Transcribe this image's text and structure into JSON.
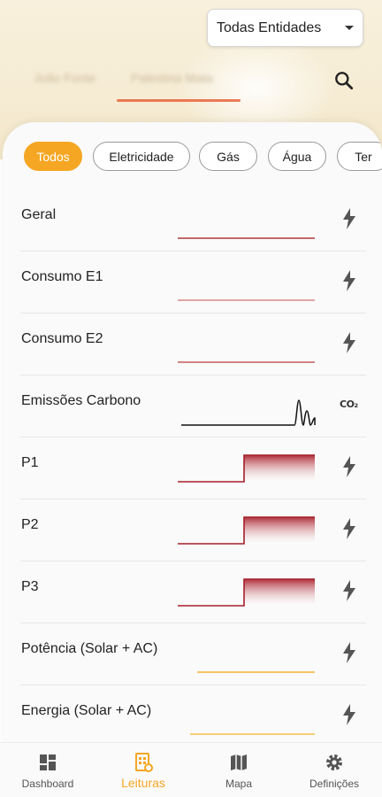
{
  "header": {
    "entity_select_value": "Todas Entidades",
    "tabs": [
      "João Fonte",
      "Palestina Mata"
    ],
    "search_icon": "search-icon",
    "colors": {
      "accent": "#f5a623",
      "tab_indicator": "#e8643c"
    }
  },
  "filters": {
    "chips": [
      {
        "label": "Todos",
        "active": true
      },
      {
        "label": "Eletricidade",
        "active": false
      },
      {
        "label": "Gás",
        "active": false
      },
      {
        "label": "Água",
        "active": false
      },
      {
        "label": "Ter",
        "active": false
      }
    ]
  },
  "readings": [
    {
      "label": "Geral",
      "icon": "bolt-icon",
      "spark_type": "flat",
      "color": "#b03a3a"
    },
    {
      "label": "Consumo E1",
      "icon": "bolt-icon",
      "spark_type": "flat",
      "color": "#d88888"
    },
    {
      "label": "Consumo E2",
      "icon": "bolt-icon",
      "spark_type": "flat",
      "color": "#c85a5a"
    },
    {
      "label": "Emissões Carbono",
      "icon": "co2-icon",
      "icon_text": "CO₂",
      "spark_type": "spike",
      "color": "#111111"
    },
    {
      "label": "P1",
      "icon": "bolt-icon",
      "spark_type": "step",
      "color": "#a31f2a"
    },
    {
      "label": "P2",
      "icon": "bolt-icon",
      "spark_type": "step",
      "color": "#a31f2a"
    },
    {
      "label": "P3",
      "icon": "bolt-icon",
      "spark_type": "step",
      "color": "#a31f2a"
    },
    {
      "label": "Potência (Solar + AC)",
      "icon": "bolt-icon",
      "spark_type": "flat-short",
      "color": "#f2b233"
    },
    {
      "label": "Energia (Solar + AC)",
      "icon": "bolt-icon",
      "spark_type": "flat-short",
      "color": "#f2c04a"
    }
  ],
  "bottom_nav": [
    {
      "label": "Dashboard",
      "icon": "dashboard-icon",
      "active": false
    },
    {
      "label": "Leituras",
      "icon": "readings-icon",
      "active": true
    },
    {
      "label": "Mapa",
      "icon": "map-icon",
      "active": false
    },
    {
      "label": "Definições",
      "icon": "settings-icon",
      "active": false
    }
  ]
}
